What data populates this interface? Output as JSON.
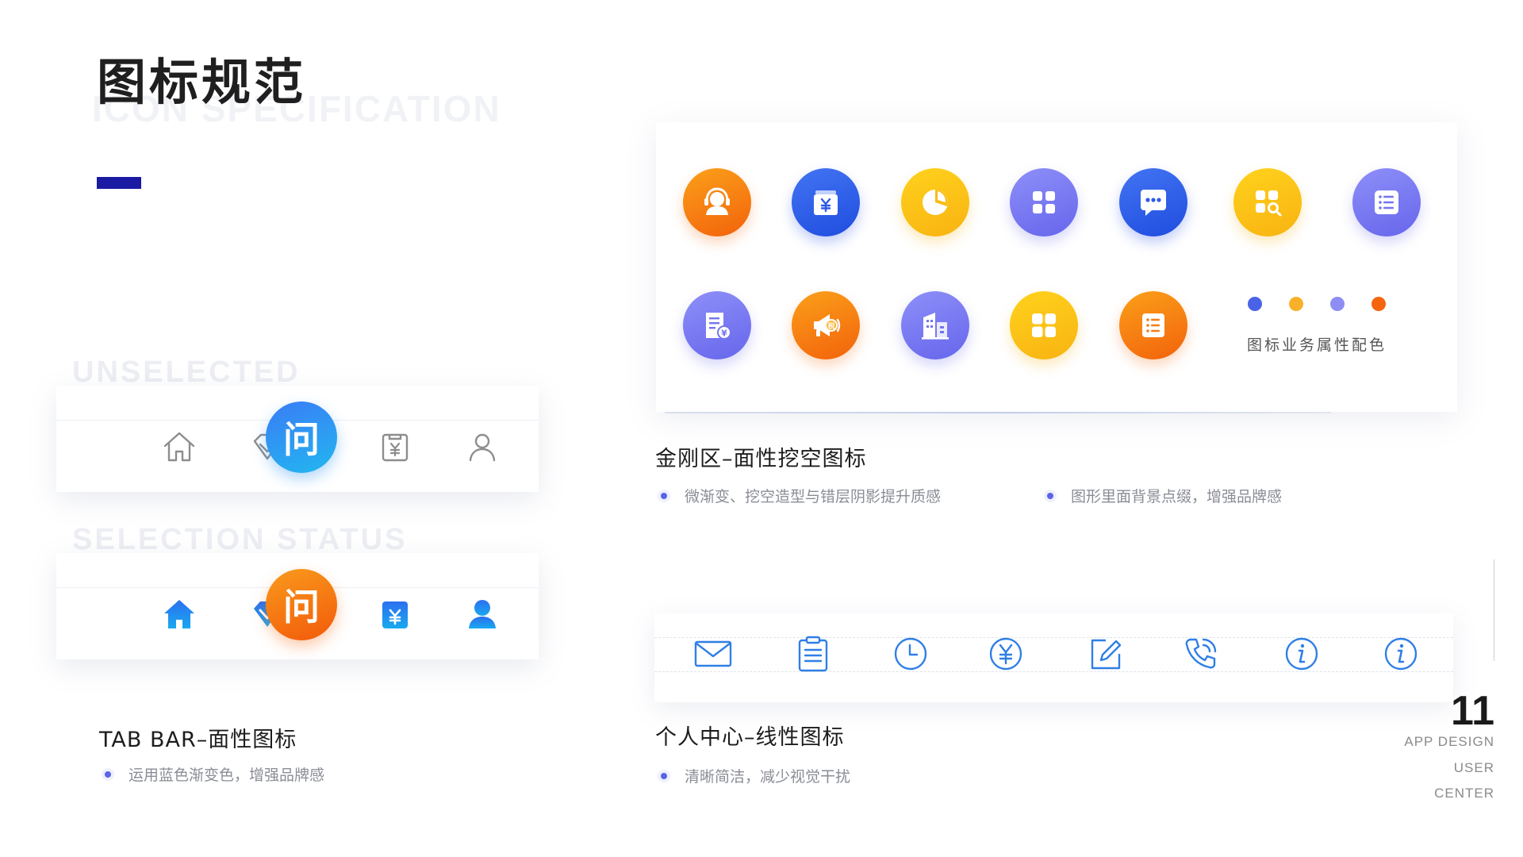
{
  "header": {
    "title": "图标规范",
    "subtitle": "ICON SPECIFICATION"
  },
  "tabbar": {
    "unselected_label": "UNSELECTED",
    "selected_label": "SELECTION STATUS",
    "center_glyph": "问",
    "icons": [
      "home-icon",
      "diamond-icon",
      "ask-icon",
      "yuan-bag-icon",
      "user-icon"
    ],
    "unselected_color": "#8d8d8d",
    "selected_color": "#1e7fe8",
    "section_title": "TAB BAR–面性图标",
    "bullets": [
      "运用蓝色渐变色，增强品牌感"
    ]
  },
  "grid": {
    "row1_icons": [
      "customer-service-icon",
      "wallet-icon",
      "pie-chart-icon",
      "apps-icon",
      "message-icon",
      "app-search-icon",
      "list-icon"
    ],
    "row2_icons": [
      "invoice-icon",
      "megaphone-icon",
      "buildings-icon",
      "grid-icon",
      "notes-icon"
    ],
    "palette": [
      "#4a63e6",
      "#f9b12a",
      "#8e8df5",
      "#f5640f"
    ],
    "palette_label": "图标业务属性配色",
    "section_title": "金刚区–面性挖空图标",
    "bullets": [
      "微渐变、挖空造型与错层阴影提升质感",
      "图形里面背景点缀，增强品牌感"
    ]
  },
  "line_icons": {
    "icons": [
      "mail-icon",
      "clipboard-icon",
      "clock-icon",
      "yuan-circle-icon",
      "edit-icon",
      "phone-icon",
      "info-icon",
      "info-icon"
    ],
    "color": "#2f7fe6",
    "section_title": "个人中心–线性图标",
    "bullets": [
      "清晰简洁，减少视觉干扰"
    ]
  },
  "footer": {
    "page_number": "11",
    "line1": "APP DESIGN",
    "line2": "USER",
    "line3": "CENTER"
  }
}
